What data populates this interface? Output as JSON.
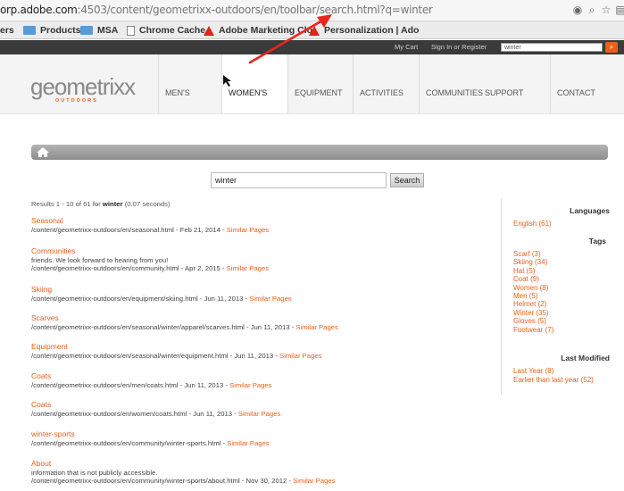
{
  "browser": {
    "url_prefix": "orp.adobe.com",
    "url_rest": ":4503/content/geometrixx-outdoors/en/toolbar/search.html?q=winter"
  },
  "bookmarks": [
    {
      "label": "ers",
      "icon": "none-icon"
    },
    {
      "label": "Products",
      "icon": "folder-icon"
    },
    {
      "label": "MSA",
      "icon": "folder-icon"
    },
    {
      "label": "Chrome Cache",
      "icon": "page-icon"
    },
    {
      "label": "Adobe Marketing Clo",
      "icon": "adobe-icon"
    },
    {
      "label": "Personalization | Ado",
      "icon": "adobe-icon"
    }
  ],
  "topbar": {
    "cart": "My Cart",
    "signin": "Sign In or Register",
    "search_value": "winter"
  },
  "logo": {
    "name": "geometrixx",
    "sub": "OUTDOORS"
  },
  "nav": [
    "MEN'S",
    "WOMEN'S",
    "EQUIPMENT",
    "ACTIVITIES",
    "COMMUNITIES",
    "SUPPORT",
    "CONTACT"
  ],
  "search": {
    "query": "winter",
    "button": "Search"
  },
  "stats": {
    "prefix": "Results 1 - 10 of 61 for",
    "term": "winter",
    "suffix": "(0.07 seconds)"
  },
  "results": [
    {
      "title": "Seasonal",
      "excerpt": "",
      "path": "/content/geometrixx-outdoors/en/seasonal.html - Feb 21, 2014 - ",
      "similar": "Similar Pages"
    },
    {
      "title": "Communities",
      "excerpt": "friends. We look forward to hearing from you!",
      "path": "/content/geometrixx-outdoors/en/community.html - Apr 2, 2015 - ",
      "similar": "Similar Pages"
    },
    {
      "title": "Skiing",
      "excerpt": "",
      "path": "/content/geometrixx-outdoors/en/equipment/skiing.html - Jun 11, 2013 - ",
      "similar": "Similar Pages"
    },
    {
      "title": "Scarves",
      "excerpt": "",
      "path": "/content/geometrixx-outdoors/en/seasonal/winter/apparel/scarves.html - Jun 11, 2013 - ",
      "similar": "Similar Pages"
    },
    {
      "title": "Equipment",
      "excerpt": "",
      "path": "/content/geometrixx-outdoors/en/seasonal/winter/equipment.html - Jun 11, 2013 - ",
      "similar": "Similar Pages"
    },
    {
      "title": "Coats",
      "excerpt": "",
      "path": "/content/geometrixx-outdoors/en/men/coats.html - Jun 11, 2013 - ",
      "similar": "Similar Pages"
    },
    {
      "title": "Coats",
      "excerpt": "",
      "path": "/content/geometrixx-outdoors/en/women/coats.html - Jun 11, 2013 - ",
      "similar": "Similar Pages"
    },
    {
      "title": "winter-sports",
      "excerpt": "",
      "path": "/content/geometrixx-outdoors/en/community/winter-sports.html - ",
      "similar": "Similar Pages"
    },
    {
      "title": "About",
      "excerpt": "information that is not publicly accessible.",
      "path": "/content/geometrixx-outdoors/en/community/winter-sports/about.html - Nov 30, 2012 - ",
      "similar": "Similar Pages"
    }
  ],
  "sidebar": {
    "languages_heading": "Languages",
    "languages": [
      "English (61)"
    ],
    "tags_heading": "Tags",
    "tags": [
      "Scarf (3)",
      "Skiing (34)",
      "Hat (5)",
      "Coat (9)",
      "Women (8)",
      "Men (5)",
      "Helmet (2)",
      "Winter (35)",
      "Gloves (5)",
      "Footwear (7)"
    ],
    "modified_heading": "Last Modified",
    "modified": [
      "Last Year (8)",
      "Earlier than last year (52)"
    ]
  },
  "colors": {
    "accent": "#e8601c",
    "annotation_arrow": "#e8261c"
  }
}
